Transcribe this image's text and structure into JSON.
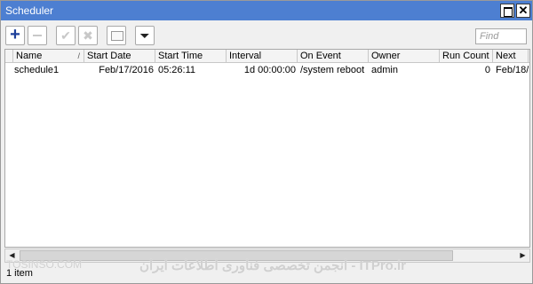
{
  "window": {
    "title": "Scheduler",
    "maximize_icon": "maximize-icon",
    "close_icon": "close-icon",
    "close_glyph": "✕"
  },
  "toolbar": {
    "add_glyph": "+",
    "add_icon": "plus-icon",
    "remove_icon": "minus-icon",
    "enable_glyph": "✔",
    "enable_icon": "checkmark-icon",
    "disable_glyph": "✖",
    "disable_icon": "cross-icon",
    "comment_icon": "comment-icon",
    "filter_glyph": "⏷",
    "filter_icon": "filter-icon",
    "find_placeholder": "Find"
  },
  "table": {
    "columns": [
      "Name",
      "Start Date",
      "Start Time",
      "Interval",
      "On Event",
      "Owner",
      "Run Count",
      "Next"
    ],
    "sort_glyph": "/",
    "rows": [
      {
        "name": "schedule1",
        "start_date": "Feb/17/2016",
        "start_time": "05:26:11",
        "interval": "1d 00:00:00",
        "on_event": "/system reboot",
        "owner": "admin",
        "run_count": "0",
        "next": "Feb/18/"
      }
    ]
  },
  "status": {
    "item_count": "1 item"
  },
  "watermark": {
    "left": "TOSINSO.COM",
    "right": "ITPro.ir - انجمن تخصصی فناوری اطلاعات ایران"
  },
  "colors": {
    "titlebar": "#4d7fd1",
    "add_icon": "#1c3f9a"
  }
}
